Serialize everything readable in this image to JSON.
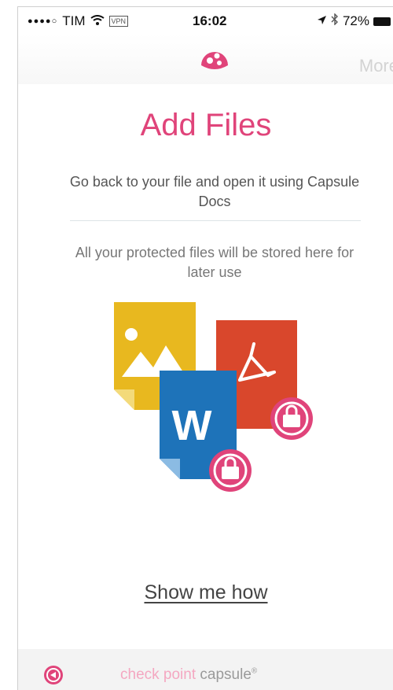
{
  "status_bar": {
    "signal": "●●●●○",
    "carrier": "TIM",
    "vpn": "VPN",
    "time": "16:02",
    "battery": "72%"
  },
  "nav": {
    "more_label": "More",
    "logo_icon": "capsule-logo-icon"
  },
  "main": {
    "title": "Add Files",
    "instruction": "Go back to your file and open it using Capsule Docs",
    "note": "All your protected files will be stored here for later use",
    "word_letter": "W",
    "show_me_label": "Show me how"
  },
  "footer": {
    "brand_part1": "check point",
    "brand_part2": "capsule",
    "brand_mark": "®",
    "icon": "capsule-circle-icon"
  },
  "colors": {
    "accent": "#e0447a",
    "image_doc": "#e8b81f",
    "pdf_doc": "#d9472c",
    "word_doc": "#1e73b9"
  }
}
